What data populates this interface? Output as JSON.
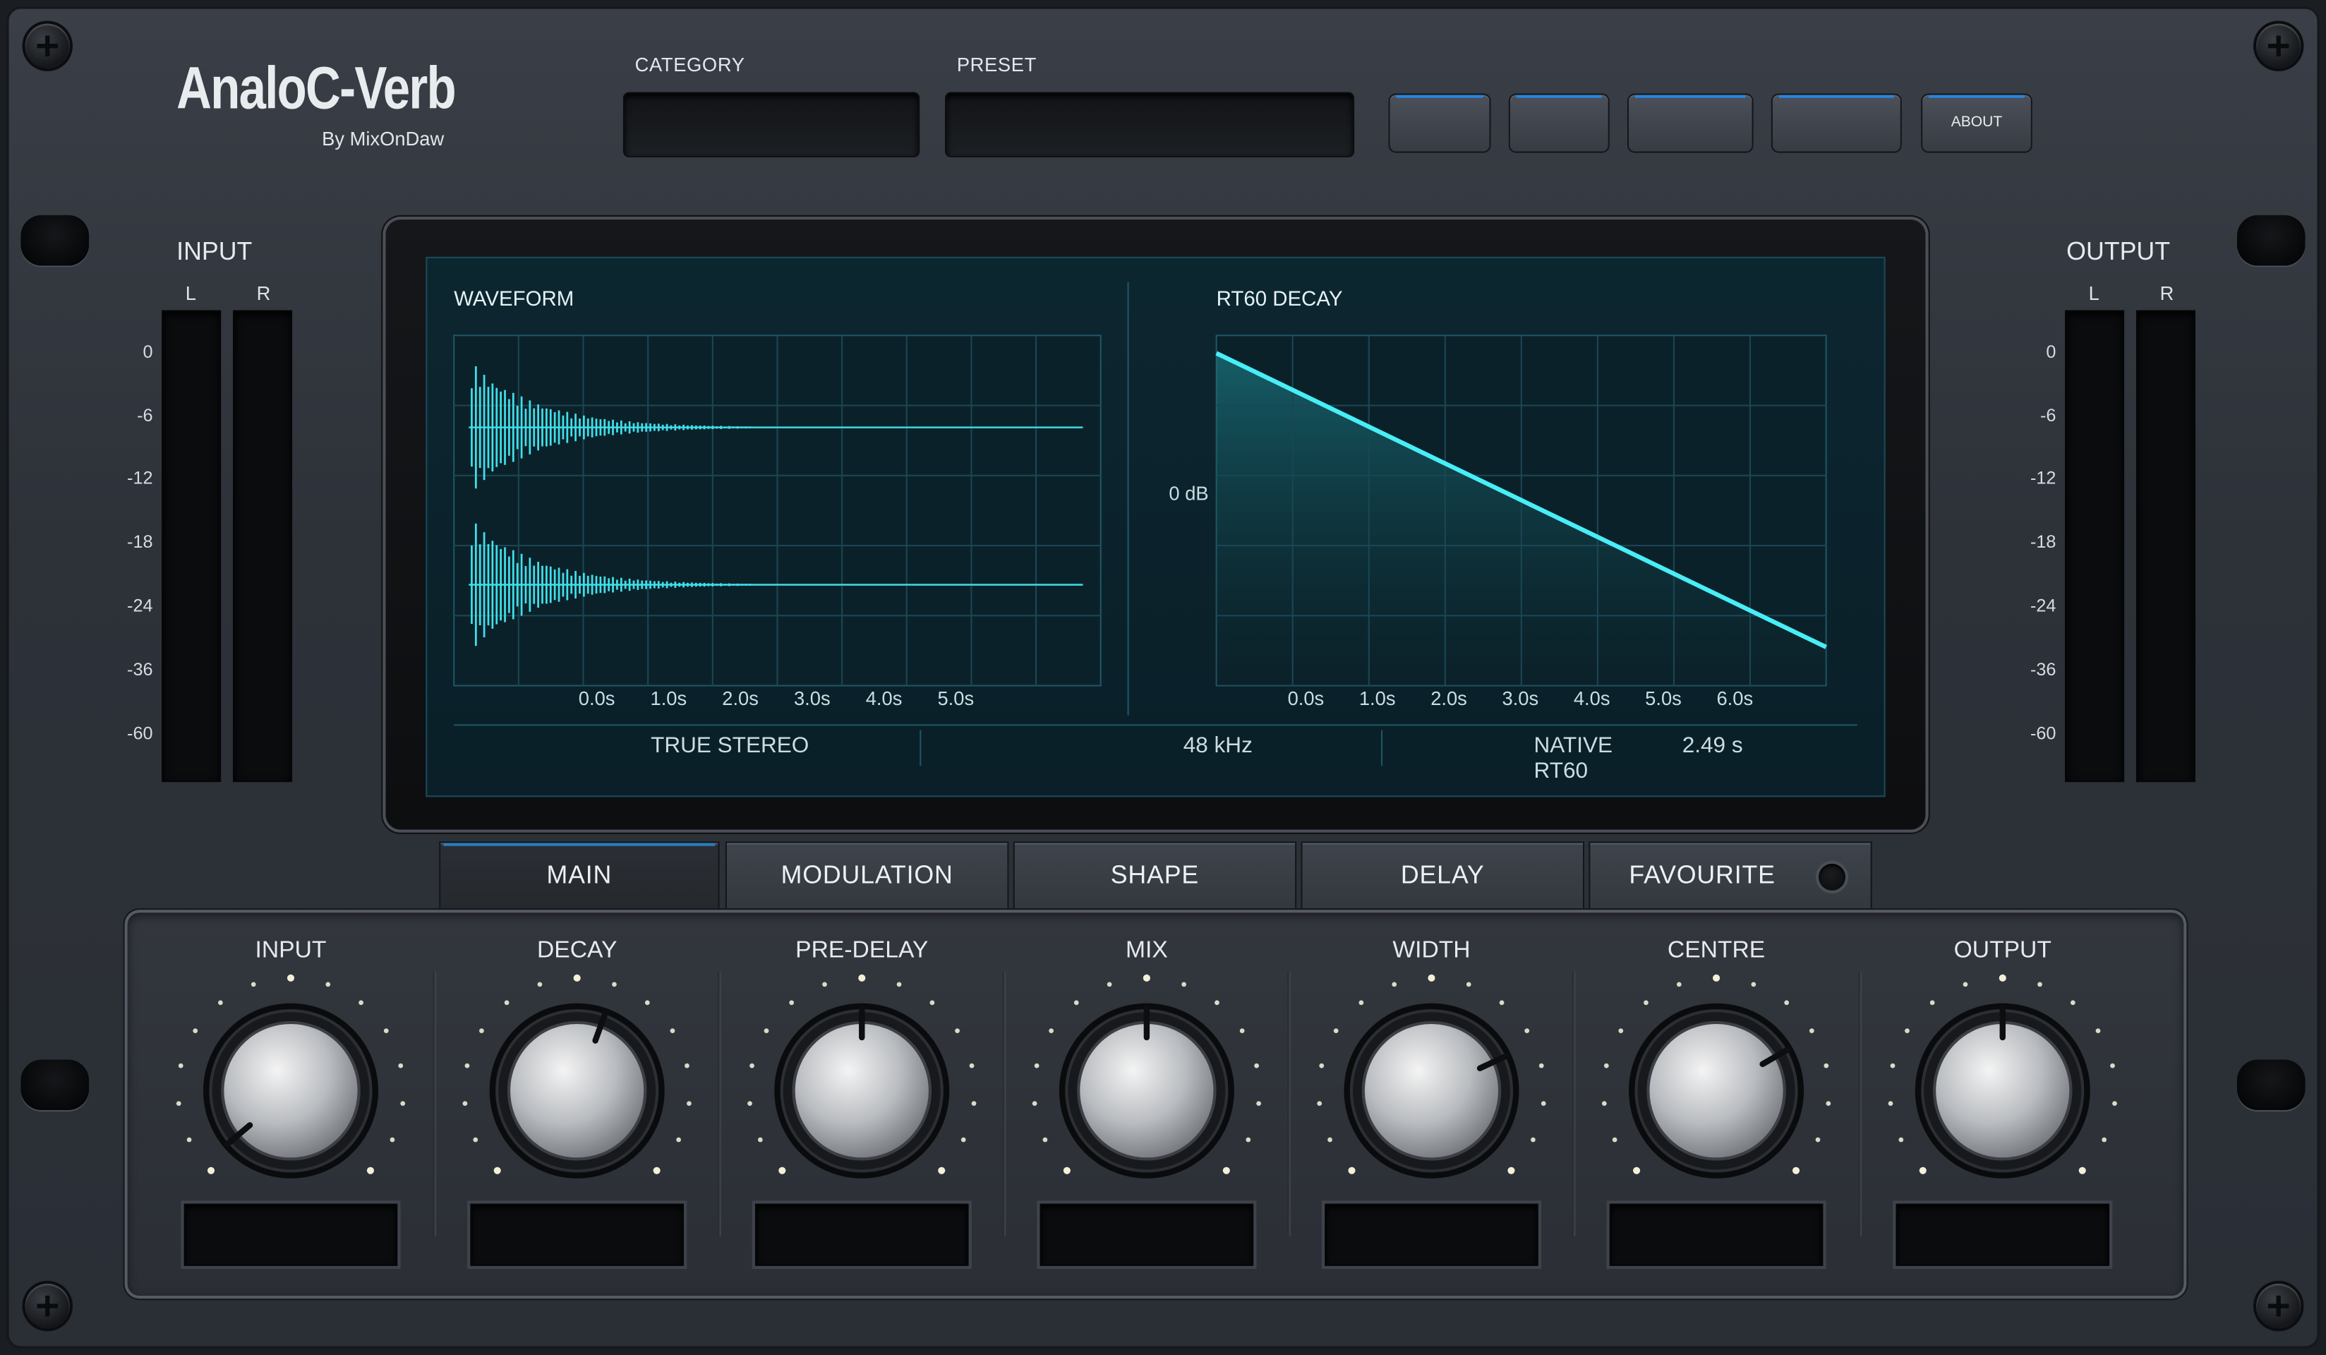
{
  "header": {
    "title": "AnaloC-Verb",
    "byline": "By MixOnDaw"
  },
  "category": {
    "label": "CATEGORY",
    "value": ""
  },
  "preset": {
    "label": "PRESET",
    "value": ""
  },
  "top_buttons": {
    "b1": "",
    "b2": "",
    "b3": "",
    "b4": "",
    "about": "ABOUT"
  },
  "input_meter": {
    "title": "INPUT",
    "left": "L",
    "right": "R"
  },
  "output_meter": {
    "title": "OUTPUT",
    "left": "L",
    "right": "R"
  },
  "meter_scale": [
    "0",
    "-6",
    "-12",
    "-18",
    "-24",
    "-36",
    "-60"
  ],
  "display": {
    "waveform_title": "WAVEFORM",
    "waveform_ticks": [
      "0.0s",
      "1.0s",
      "2.0s",
      "3.0s",
      "4.0s",
      "5.0s"
    ],
    "decay_title": "RT60 DECAY",
    "decay_ylabel": "0 dB",
    "decay_ticks": [
      "0.0s",
      "1.0s",
      "2.0s",
      "3.0s",
      "4.0s",
      "5.0s",
      "6.0s"
    ],
    "mode": "TRUE STEREO",
    "samplerate": "48 kHz",
    "rt60_label": "NATIVE RT60",
    "rt60_value": "2.49 s"
  },
  "tabs": [
    {
      "label": "MAIN",
      "active": true
    },
    {
      "label": "MODULATION",
      "active": false
    },
    {
      "label": "SHAPE",
      "active": false
    },
    {
      "label": "DELAY",
      "active": false
    },
    {
      "label": "FAVOURITE",
      "active": false
    }
  ],
  "knobs": [
    {
      "label": "INPUT",
      "value": "",
      "angle_deg": -130
    },
    {
      "label": "DECAY",
      "value": "",
      "angle_deg": 20
    },
    {
      "label": "PRE-DELAY",
      "value": "",
      "angle_deg": 0
    },
    {
      "label": "MIX",
      "value": "",
      "angle_deg": 0
    },
    {
      "label": "WIDTH",
      "value": "",
      "angle_deg": 65
    },
    {
      "label": "CENTRE",
      "value": "",
      "angle_deg": 60
    },
    {
      "label": "OUTPUT",
      "value": "",
      "angle_deg": 0
    }
  ],
  "colors": {
    "accent": "#2ee6f0",
    "screen_bg": "#0b2129",
    "tab_active": "#2a7fbf"
  }
}
